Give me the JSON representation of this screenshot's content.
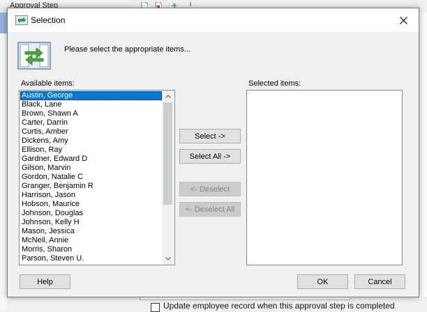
{
  "background": {
    "left_header": "Approval Step",
    "checkbox_label": "Update employee record when this approval step is completed"
  },
  "dialog": {
    "title": "Selection",
    "prompt": "Please select the appropriate items...",
    "available_label": "Available items:",
    "selected_label": "Selected items:",
    "available_items": [
      "Austin, George",
      "Black, Lane",
      "Brown, Shawn A",
      "Carter, Darrin",
      "Curtis, Amber",
      "Dickens, Amy",
      "Ellison, Ray",
      "Gardner, Edward D",
      "Gilson, Marvin",
      "Gordon, Natalie C",
      "Granger, Benjamin R",
      "Harrison, Jason",
      "Hobson, Maurice",
      "Johnson, Douglas",
      "Johnson, Kelly H",
      "Mason, Jessica",
      "McNeil, Annie",
      "Morris, Sharon",
      "Parson, Steven U."
    ],
    "selected_index": 0,
    "selected_items": [],
    "buttons": {
      "select": "Select ->",
      "select_all": "Select All ->",
      "deselect": "<- Deselect",
      "deselect_all": "<- Deselect All",
      "help": "Help",
      "ok": "OK",
      "cancel": "Cancel"
    }
  },
  "colors": {
    "selection": "#0078d7",
    "accent_green": "#3a9a2a",
    "accent_blue": "#2a6fc0"
  }
}
